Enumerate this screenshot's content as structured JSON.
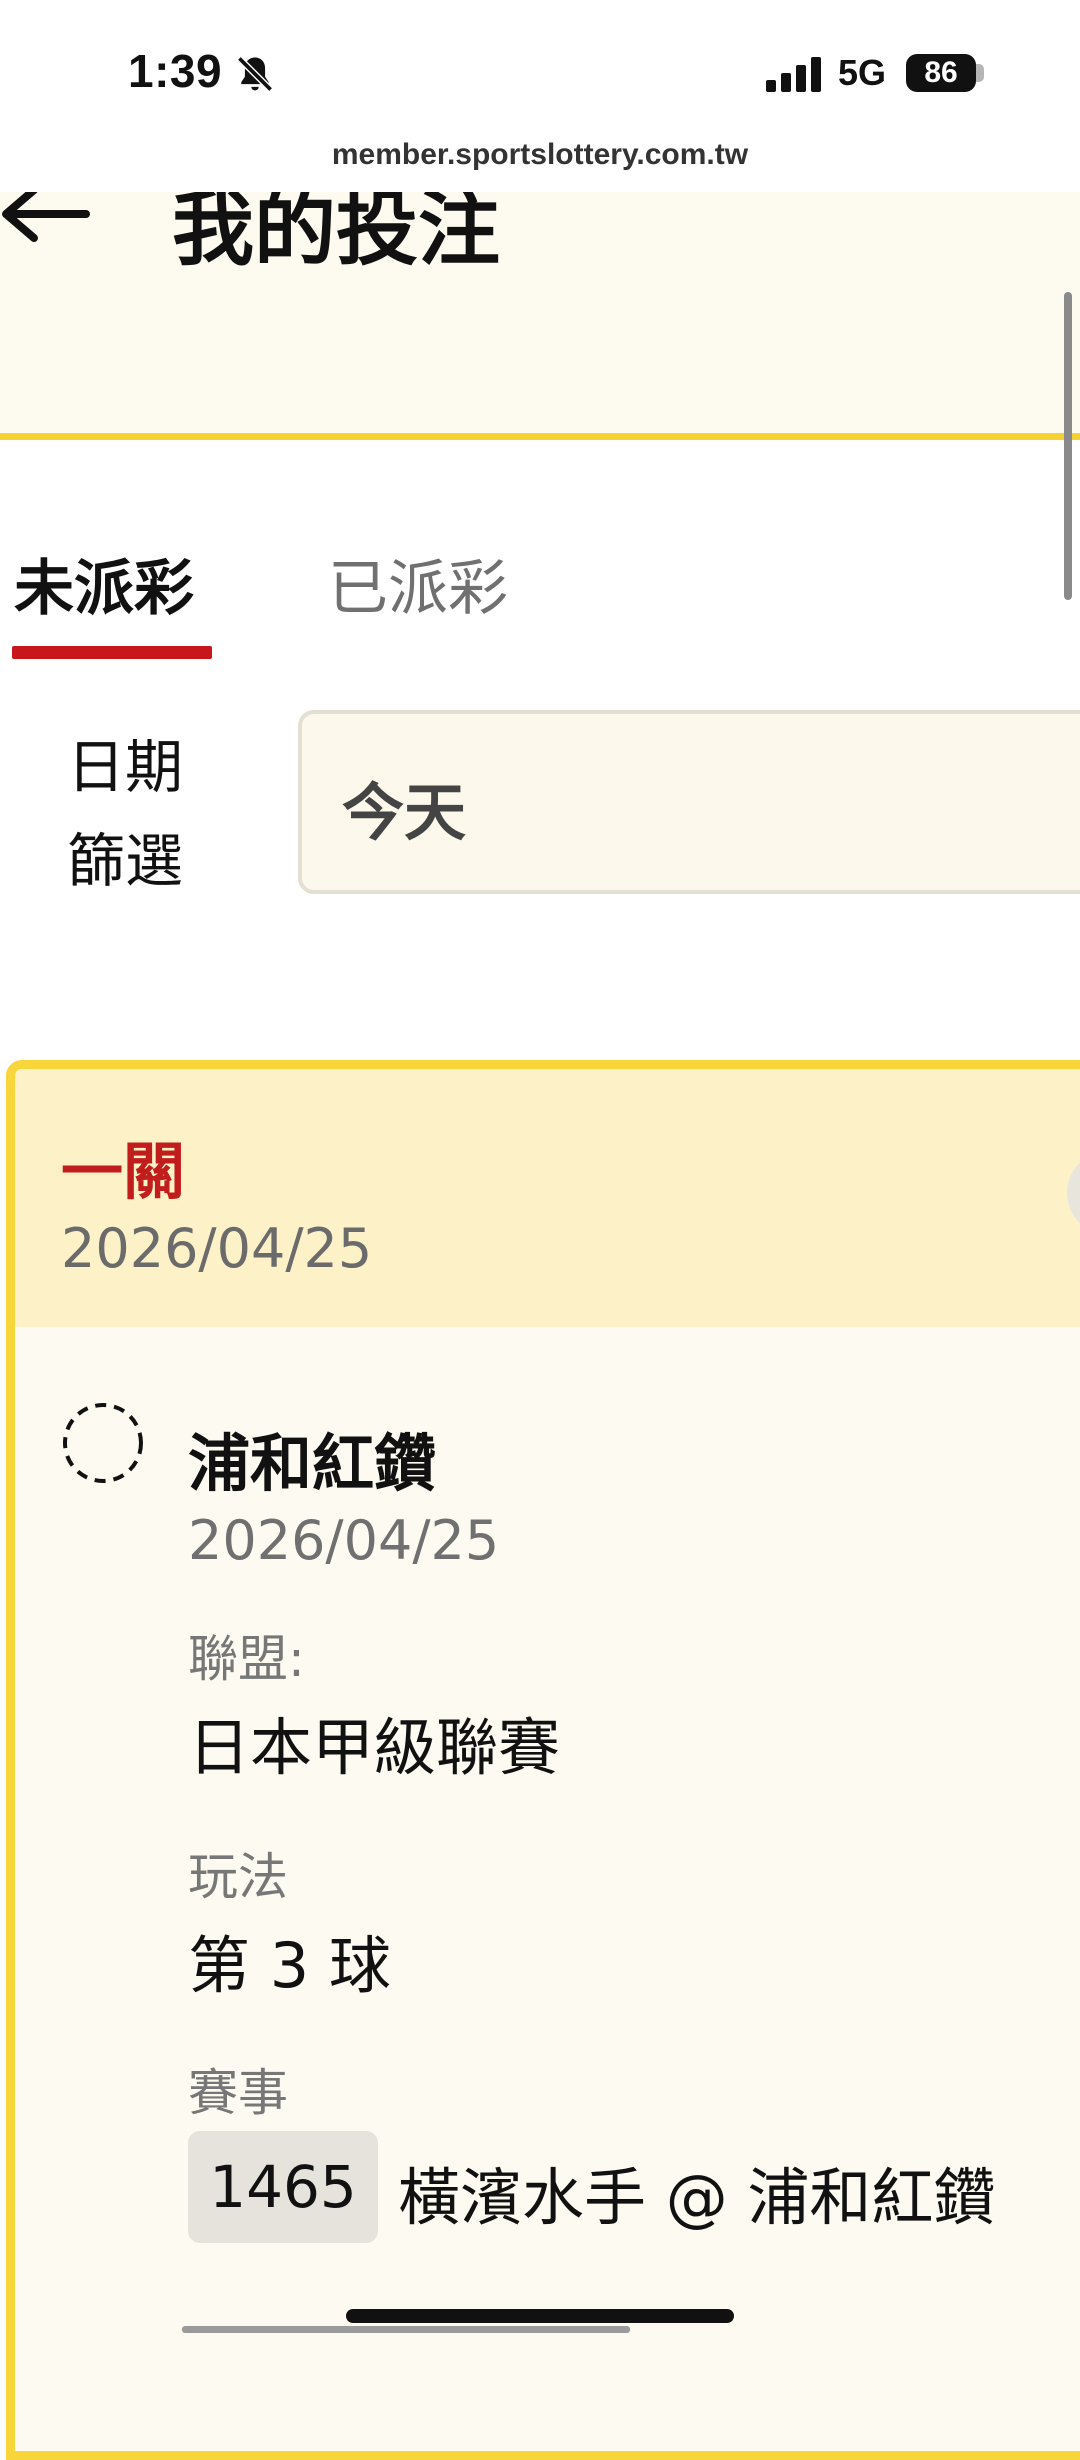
{
  "status_bar": {
    "time": "1:39",
    "network": "5G",
    "battery": "86"
  },
  "browser": {
    "url": "member.sportslottery.com.tw"
  },
  "header": {
    "title": "我的投注"
  },
  "tabs": [
    {
      "label": "未派彩",
      "active": true
    },
    {
      "label": "已派彩",
      "active": false
    }
  ],
  "filter": {
    "label_line1": "日期",
    "label_line2": "篩選",
    "value": "今天"
  },
  "bet": {
    "type": "一關",
    "date": "2026/04/25",
    "selection": {
      "team": "浦和紅鑽",
      "date": "2026/04/25",
      "league_label": "聯盟:",
      "league": "日本甲級聯賽",
      "market_label": "玩法",
      "market": "第 3 球",
      "event_label": "賽事",
      "event_code": "1465",
      "event_name": "橫濱水手 @ 浦和紅鑽"
    }
  },
  "colors": {
    "accent_yellow": "#f5d232",
    "tab_underline": "#c8161d",
    "bet_type_red": "#c21d1d"
  }
}
